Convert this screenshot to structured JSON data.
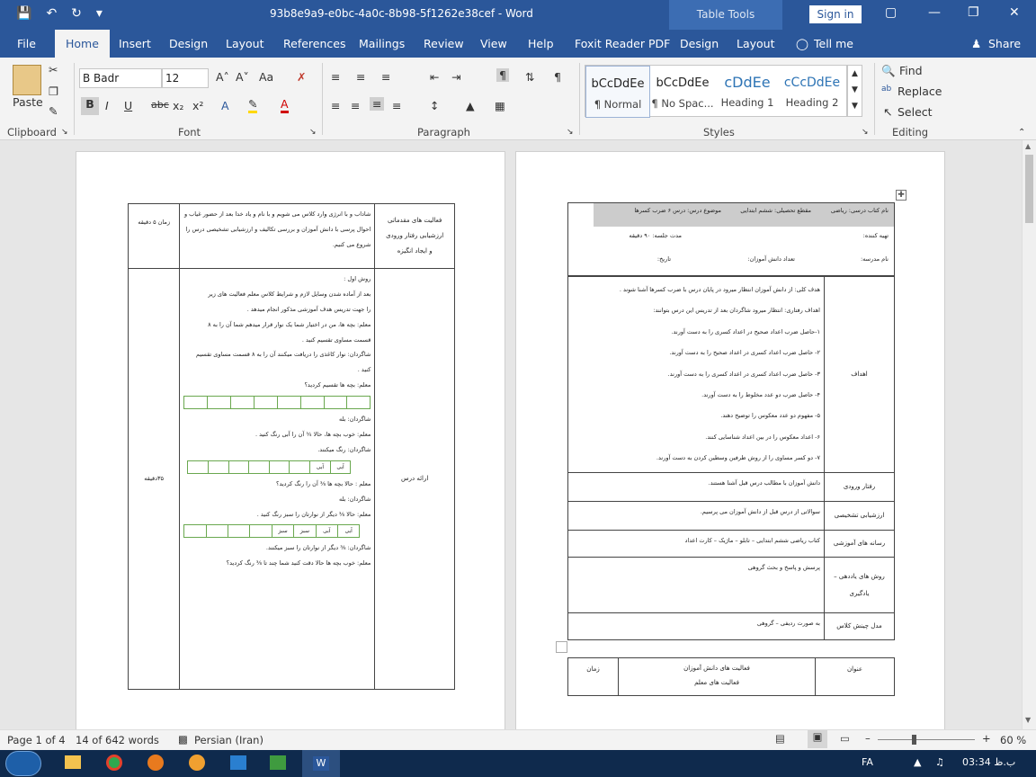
{
  "window": {
    "title": "93b8e9a9-e0bc-4a0c-8b98-5f1262e38cef - Word",
    "context_tab": "Table Tools",
    "signin_label": "Sign in"
  },
  "tabs": [
    {
      "label": "File"
    },
    {
      "label": "Home"
    },
    {
      "label": "Insert"
    },
    {
      "label": "Design"
    },
    {
      "label": "Layout"
    },
    {
      "label": "References"
    },
    {
      "label": "Mailings"
    },
    {
      "label": "Review"
    },
    {
      "label": "View"
    },
    {
      "label": "Help"
    },
    {
      "label": "Foxit Reader PDF"
    },
    {
      "label": "Design"
    },
    {
      "label": "Layout"
    },
    {
      "label": "Tell me"
    },
    {
      "label": "Share"
    }
  ],
  "ribbon": {
    "paste_label": "Paste",
    "font_name": "B Badr",
    "font_size": "12",
    "groups": {
      "clipboard": "Clipboard",
      "font": "Font",
      "paragraph": "Paragraph",
      "styles": "Styles",
      "editing": "Editing"
    },
    "styles": [
      {
        "sample": "bCcDdEe",
        "label": "¶ Normal"
      },
      {
        "sample": "bCcDdEe",
        "label": "¶ No Spac..."
      },
      {
        "sample": "cDdEe",
        "label": "Heading 1"
      },
      {
        "sample": "cCcDdEe",
        "label": "Heading 2"
      }
    ],
    "editing": {
      "find": "Find",
      "replace": "Replace",
      "select": "Select"
    },
    "font_buttons": {
      "bold": "B",
      "italic": "I",
      "underline": "U",
      "strike": "abc",
      "sub": "x₂",
      "sup": "x²"
    }
  },
  "right_page": {
    "header": {
      "book": "نام کتاب درسی: ریاضی",
      "grade": "مقطع تحصیلی: ششم ابتدایی",
      "topic": "موضوع درس: درس ۶ ضرب کسرها",
      "prepared_by": "تهیه کننده:",
      "duration": "مدت جلسه: ۹۰ دقیقه",
      "school": "نام مدرسه:",
      "students": "تعداد دانش آموزان:",
      "date": "تاریخ:"
    },
    "rows": [
      {
        "label": "اهداف",
        "lines": [
          "هدف کلی: از دانش آموزان انتظار میرود در پایان درس با ضرب کسرها آشنا شوند .",
          "اهداف رفتاری: انتظار میرود شاگردان بعد از تدریس این درس بتوانند:",
          "۱-حاصل ضرب اعداد صحیح در اعداد کسری را به دست آورند.",
          "۲- حاصل ضرب اعداد کسری در اعداد صحیح را به دست آورند.",
          "۳- حاصل ضرب اعداد کسری در اعداد کسری را به دست آورند.",
          "۴- حاصل ضرب دو عدد مخلوط را به دست آورند.",
          "۵- مفهوم دو عدد معکوس را توضیح دهند.",
          "۶- اعداد معکوس را در بین اعداد شناسایی کنند.",
          "۷- دو کسر مساوی را از روش طرفین وسطین کردن به دست آورند."
        ]
      },
      {
        "label": "رفتار ورودی",
        "lines": [
          "دانش آموزان با مطالب درس قبل آشنا هستند."
        ]
      },
      {
        "label": "ارزشیابی تشخیصی",
        "lines": [
          "سوالاتی از درس قبل از دانش آموزان می پرسیم."
        ]
      },
      {
        "label": "رسانه های آموزشی",
        "lines": [
          "کتاب ریاضی ششم ابتدایی – تابلو – ماژیک – کارت اعداد"
        ]
      },
      {
        "label": "روش های یاددهی – یادگیری",
        "lines": [
          "پرسش و پاسخ و بحث گروهی"
        ]
      },
      {
        "label": "مدل چینش کلاس",
        "lines": [
          "به صورت ردیفی – گروهی"
        ]
      }
    ],
    "bottom_table": {
      "title": "عنوان",
      "student_activities": "فعالیت های دانش آموزان",
      "teacher_activities": "فعالیت های معلم",
      "time": "زمان"
    }
  },
  "left_page": {
    "row1": {
      "label_lines": [
        "فعالیت های مقدماتی",
        "ارزشیابی رفتار ورودی",
        "و ایجاد انگیزه"
      ],
      "text": "شاداب و با انرژی وارد کلاس می شویم و با نام و یاد خدا بعد از حضور غیاب و احوال پرسی با دانش آموزان و بررسی تکالیف و ارزشیابی تشخیصی درس را شروع می کنیم.",
      "time": "زمان ۵ دقیقه"
    },
    "row2": {
      "label": "ارائه درس",
      "time": "۳۵دقیقه",
      "lines": [
        "روش اول :",
        "بعد از آماده شدن وسایل لازم و شرایط کلاس معلم فعالیت های زیر",
        "را جهت تدریس هدف آموزشی مذکور انجام میدهد .",
        "معلم: بچه ها، من در اختیار شما یک نوار قرار میدهم شما آن را به ۸",
        "قسمت مساوی تقسیم کنید .",
        "شاگردان: نوار کاغذی را دریافت میکنند آن را به ۸ قسمت مساوی تقسیم",
        "کنید .",
        "معلم: بچه ها تقسیم کردید؟"
      ],
      "lines_b": [
        "شاگردان: بله",
        "معلم: خوب بچه ها، حالا ¾ آن را آبی رنگ کنید .",
        "شاگردان: رنگ میکنند."
      ],
      "lines_c": [
        "معلم : حالا بچه ها ⅜ آن را رنگ کردید؟",
        "شاگردان: بله",
        "معلم: حالا ⅜ دیگر از نوارتان را سبز رنگ کنید ."
      ],
      "lines_d": [
        "شاگردان: ⅜ دیگر از نوارتان را سبز میکنند.",
        "معلم: خوب بچه ها حالا دقت کنید شما چند تا ⅜ رنگ کردید؟"
      ],
      "strip2": [
        "آبی",
        "آبی",
        "",
        "",
        "",
        "",
        "",
        ""
      ],
      "strip3": [
        "آبی",
        "آبی",
        "سبز",
        "سبز",
        "",
        "",
        "",
        ""
      ]
    }
  },
  "status": {
    "page": "Page 1 of 4",
    "words": "14 of 642 words",
    "language": "Persian (Iran)",
    "zoom": "60 %"
  },
  "taskbar": {
    "lang": "FA",
    "time": "03:34 ب.ظ"
  }
}
